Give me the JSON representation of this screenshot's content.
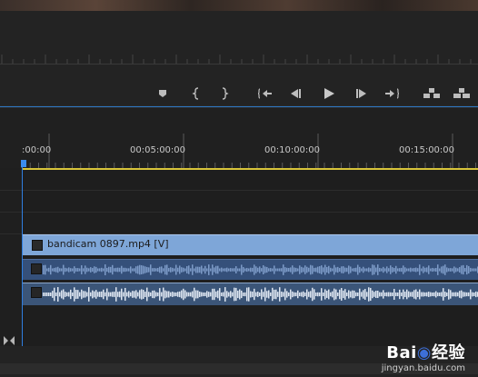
{
  "timeline": {
    "timecodes": [
      ":00:00",
      "00:05:00:00",
      "00:10:00:00",
      "00:15:00:00"
    ],
    "video_clip_name": "bandicam 0897.mp4 [V]"
  },
  "transport": {
    "buttons": [
      "add-marker",
      "mark-in",
      "mark-out",
      "go-to-in",
      "step-back",
      "play",
      "step-forward",
      "go-to-out",
      "lift",
      "extract"
    ]
  },
  "watermark": {
    "logo_prefix": "Bai",
    "logo_suffix": "经验",
    "url": "jingyan.baidu.com"
  }
}
